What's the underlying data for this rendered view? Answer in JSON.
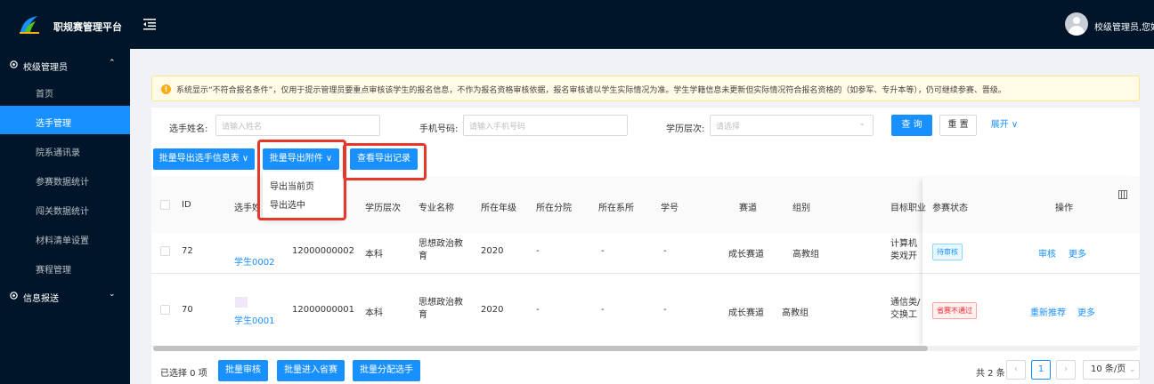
{
  "app": {
    "title": "职规赛管理平台",
    "user": "校级管理员,您好"
  },
  "sidebar": {
    "group1": "校级管理员",
    "items": [
      "首页",
      "选手管理",
      "院系通讯录",
      "参赛数据统计",
      "闯关数据统计",
      "材料清单设置",
      "赛程管理"
    ],
    "group2": "信息报送"
  },
  "notice": "系统显示“不符合报名条件”，仅用于提示管理员要重点审核该学生的报名信息，不作为报名资格审核依据，报名审核请以学生实际情况为准。学生学籍信息未更新但实际情况符合报名资格的（如参军、专升本等），仍可继续参赛、晋级。",
  "filters": {
    "name_label": "选手姓名:",
    "name_placeholder": "请输入姓名",
    "phone_label": "手机号码:",
    "phone_placeholder": "请输入手机号码",
    "edu_label": "学历层次:",
    "edu_placeholder": "请选择",
    "search": "查 询",
    "reset": "重 置",
    "expand": "展开"
  },
  "actions": {
    "export_info": "批量导出选手信息表",
    "export_attach": "批量导出附件",
    "view_records": "查看导出记录"
  },
  "dropdown": [
    "导出当前页",
    "导出选中"
  ],
  "table": {
    "headers": [
      "ID",
      "选手姓名",
      "学历层次",
      "专业名称",
      "所在年级",
      "所在分院",
      "所在系所",
      "学号",
      "赛道",
      "组别",
      "目标职业",
      "参赛状态",
      "操作"
    ],
    "rows": [
      {
        "id": "72",
        "name": "学生0002",
        "phone": "12000000002",
        "edu": "本科",
        "major": "思想政治教育",
        "grade": "2020",
        "college": "-",
        "dept": "-",
        "sno": "-",
        "track": "成长赛道",
        "group": "高教组",
        "career": "计算机类戏开发工",
        "status": "待审核",
        "op1": "审核",
        "op2": "更多"
      },
      {
        "id": "70",
        "name": "学生0001",
        "phone": "12000000001",
        "edu": "本科",
        "major": "思想政治教育",
        "grade": "2020",
        "college": "-",
        "dept": "-",
        "sno": "-",
        "track": "成长赛道",
        "group": "高教组",
        "career": "通信类/交换工程",
        "status": "省赛不通过",
        "op1": "重新推荐",
        "op2": "更多"
      }
    ]
  },
  "footer": {
    "selected": "已选择 0 项",
    "batch_review": "批量审核",
    "batch_province": "批量进入省赛",
    "batch_assign": "批量分配选手",
    "total": "共 2 条",
    "page": "1",
    "page_size": "10 条/页"
  }
}
